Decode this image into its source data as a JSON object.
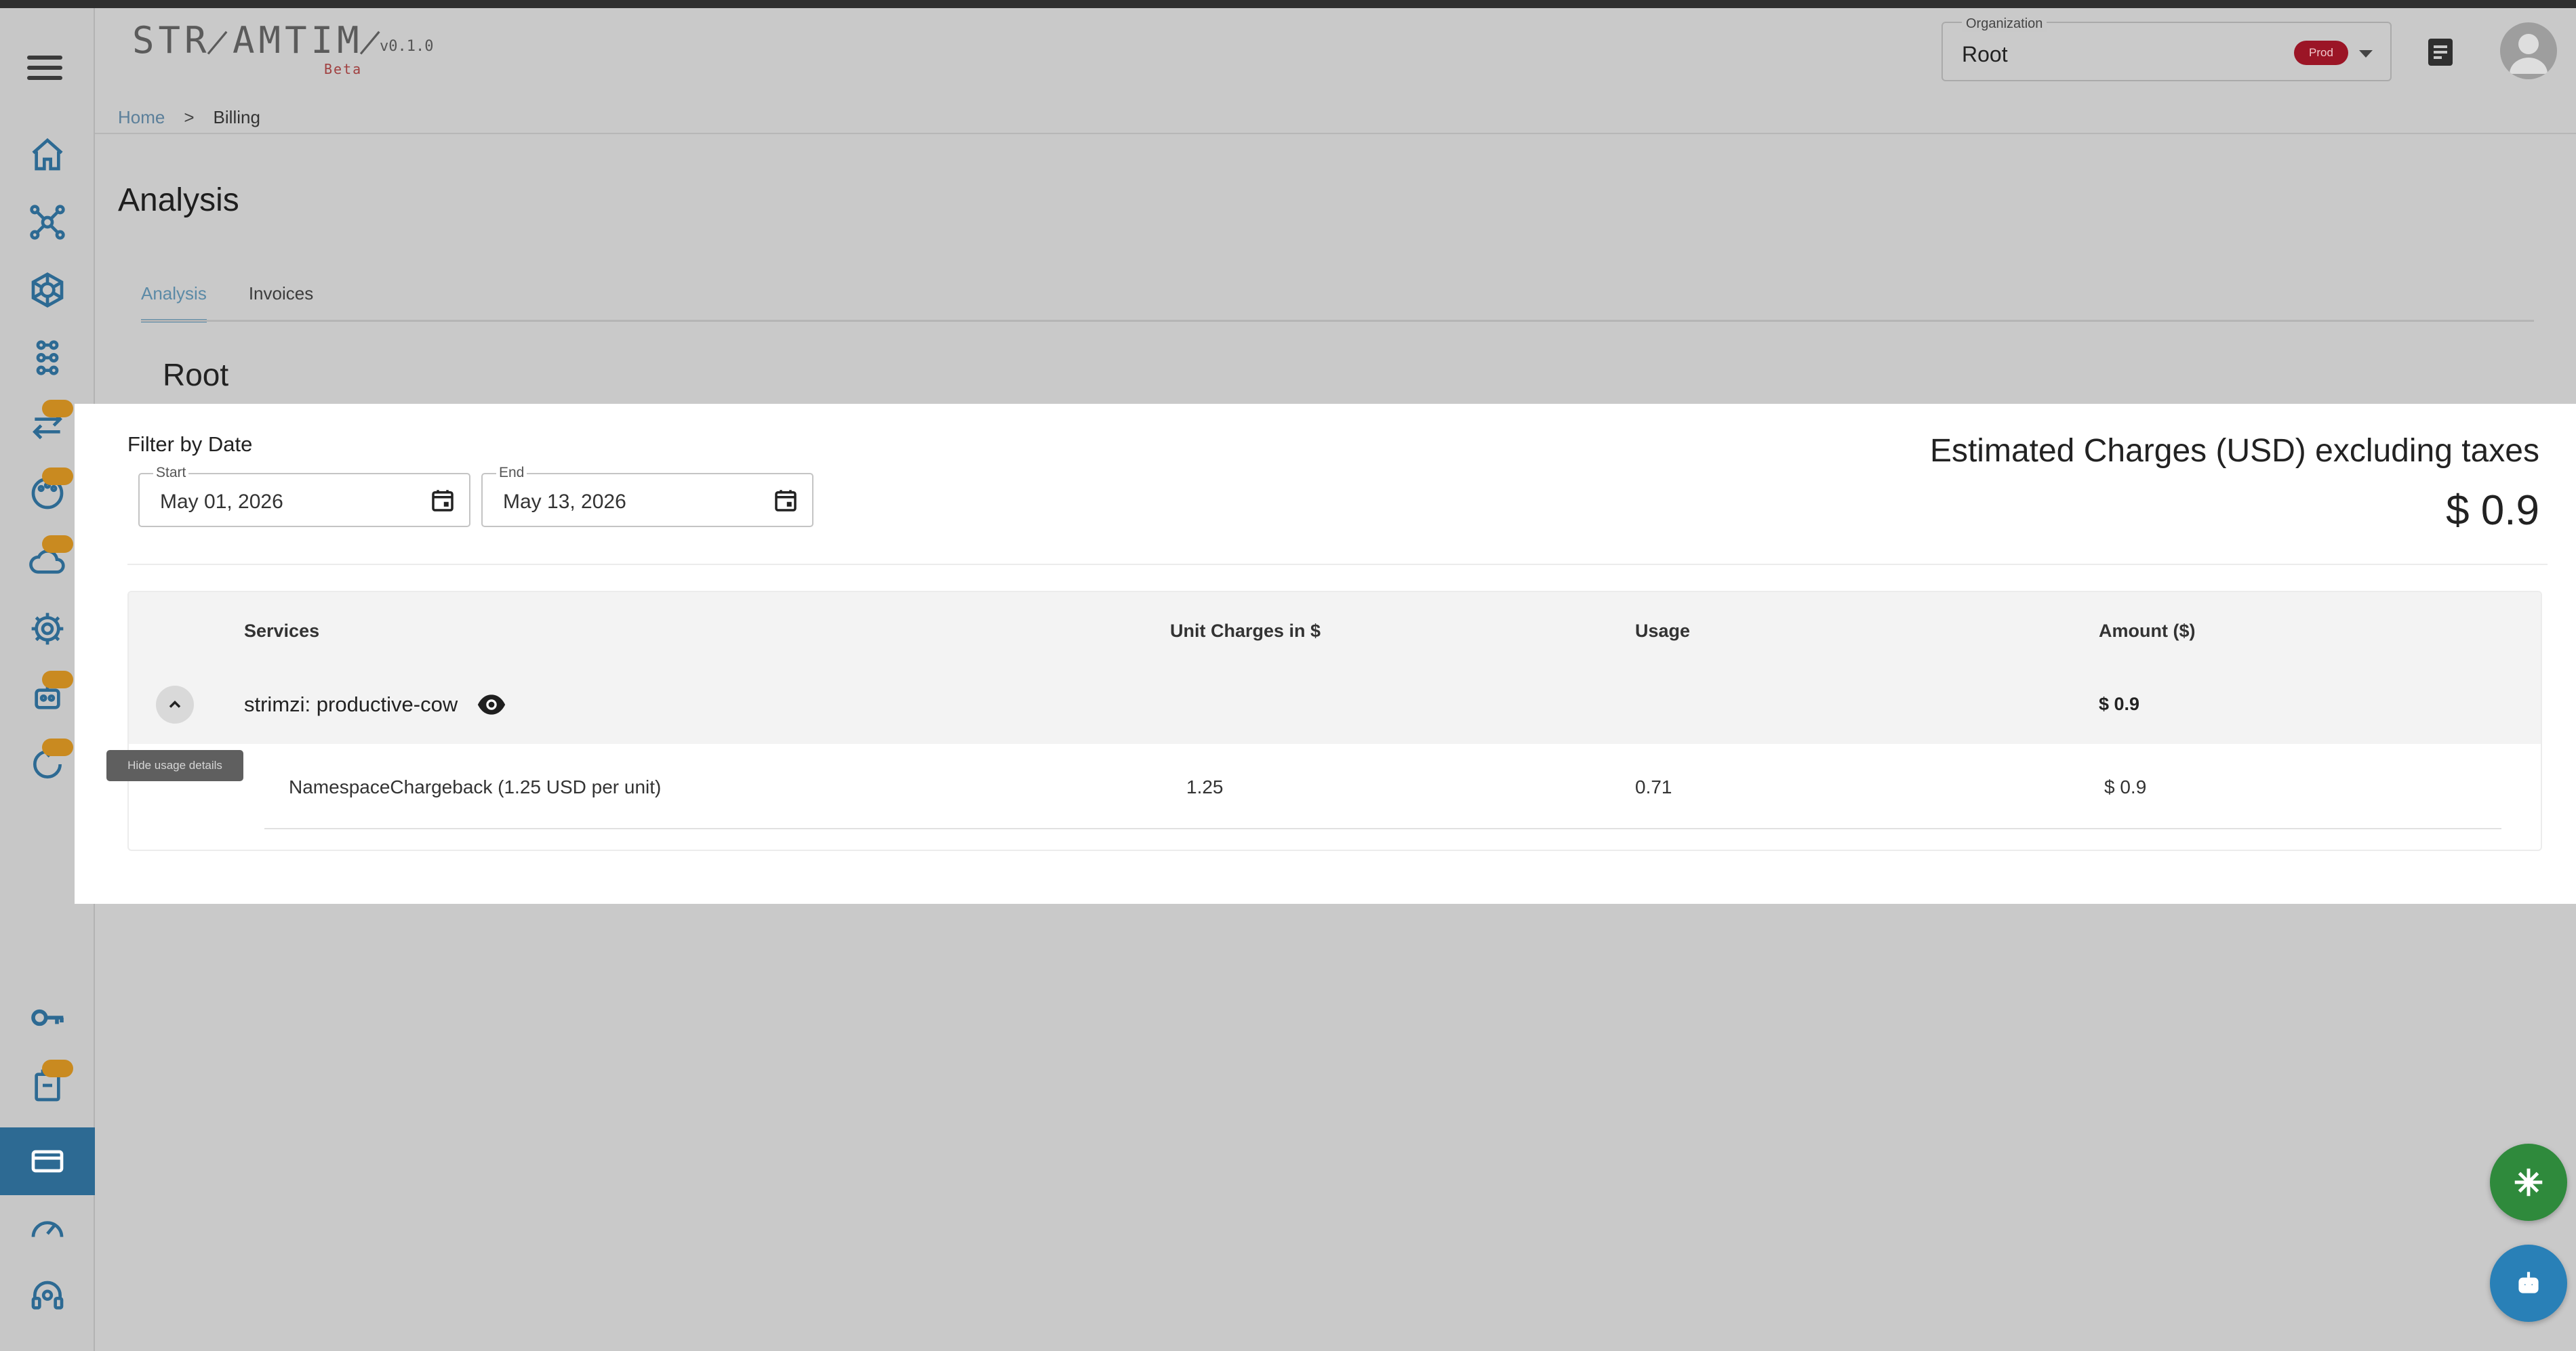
{
  "app": {
    "logo_text": "STR̷AMTIM̷",
    "logo_version": "v0.1.0",
    "logo_tag": "Beta"
  },
  "header": {
    "organization_label": "Organization",
    "organization_value": "Root",
    "organization_badge": "Prod"
  },
  "breadcrumb": {
    "home": "Home",
    "separator": ">",
    "current": "Billing"
  },
  "page": {
    "title": "Analysis",
    "tabs": [
      {
        "label": "Analysis",
        "active": true
      },
      {
        "label": "Invoices",
        "active": false
      }
    ],
    "org_name": "Root"
  },
  "filter": {
    "label": "Filter by Date",
    "start_label": "Start",
    "start_value": "May 01, 2026",
    "end_label": "End",
    "end_value": "May 13, 2026"
  },
  "estimate": {
    "label": "Estimated Charges (USD) excluding taxes",
    "value": "$ 0.9"
  },
  "table": {
    "headers": [
      "Services",
      "Unit Charges in $",
      "Usage",
      "Amount ($)"
    ],
    "group": {
      "name": "strimzi: productive-cow",
      "amount": "$ 0.9"
    },
    "rows": [
      {
        "service": "NamespaceChargeback (1.25 USD per unit)",
        "unit_charge": "1.25",
        "usage": "0.71",
        "amount": "$ 0.9"
      }
    ]
  },
  "tooltip": {
    "text": "Hide usage details"
  },
  "sidebar": {
    "items": [
      {
        "icon": "home-icon"
      },
      {
        "icon": "network-icon"
      },
      {
        "icon": "helm-wheel-icon"
      },
      {
        "icon": "cluster-icon"
      },
      {
        "icon": "transfer-icon"
      },
      {
        "icon": "palette-icon"
      },
      {
        "icon": "cloud-icon"
      },
      {
        "icon": "settings-icon"
      },
      {
        "icon": "robot-icon"
      },
      {
        "icon": "sync-icon"
      },
      {
        "icon": "key-icon"
      },
      {
        "icon": "clipboard-icon"
      },
      {
        "icon": "credit-card-icon"
      },
      {
        "icon": "speed-icon"
      },
      {
        "icon": "support-icon"
      }
    ]
  },
  "colors": {
    "accent": "#2d6a93",
    "tab_active": "#5b8aa6",
    "badge": "#c98a20",
    "prod_badge": "#9b1526",
    "fab_green": "#2f8a3c",
    "fab_blue": "#2980b7"
  }
}
